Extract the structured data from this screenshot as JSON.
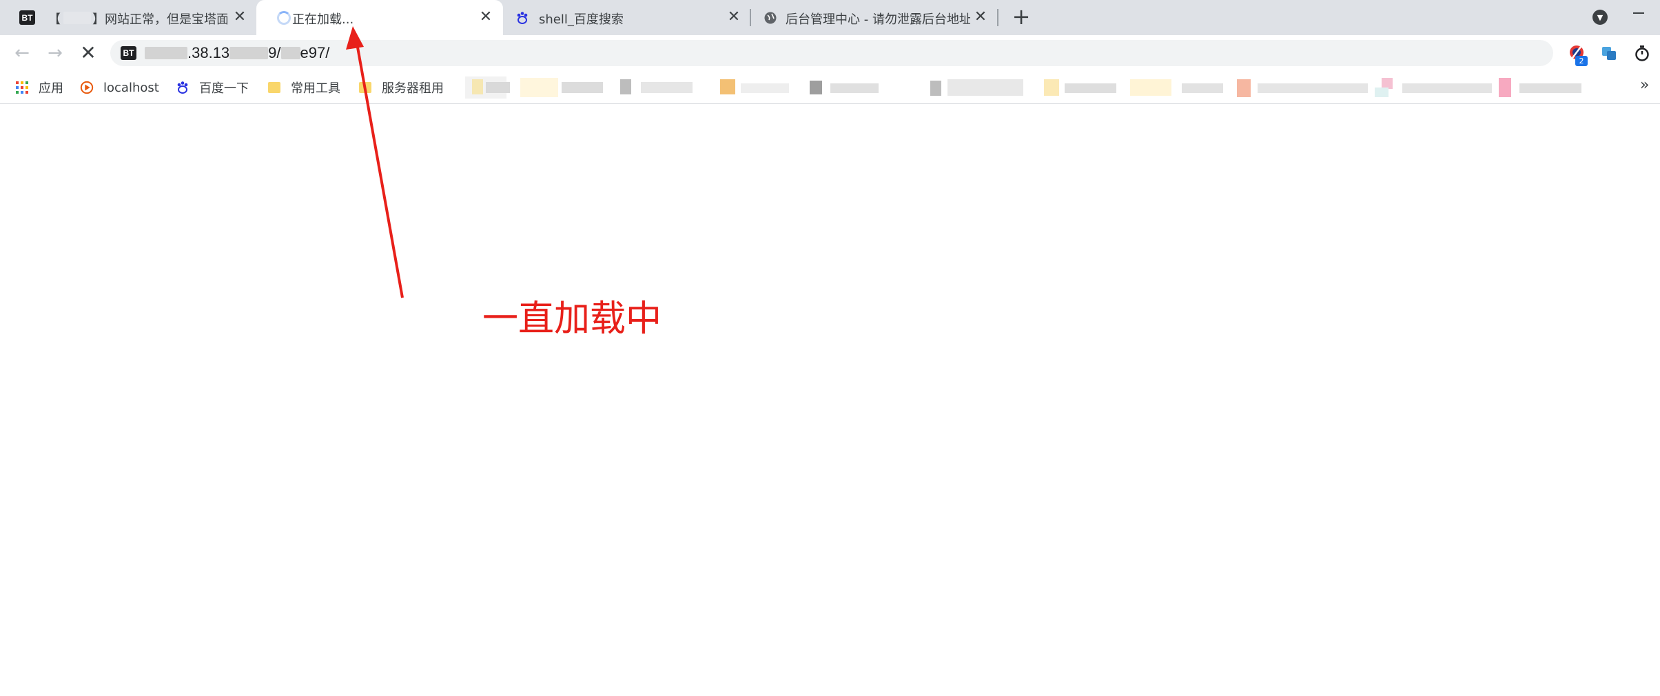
{
  "tabs": [
    {
      "favicon": "bt-badge-icon",
      "prefix": "【",
      "title": "】网站正常，但是宝塔面",
      "active": false
    },
    {
      "favicon": "loading-spinner-icon",
      "title": "正在加载...",
      "active": true
    },
    {
      "favicon": "baidu-paw-icon",
      "title": "shell_百度搜索",
      "active": false
    },
    {
      "favicon": "globe-icon",
      "title": "后台管理中心 - 请勿泄露后台地址",
      "active": false
    }
  ],
  "tab_badge_text": "BT",
  "new_tab_label": "+",
  "address_bar": {
    "site_badge": "BT",
    "url_part1": ".38.13",
    "url_part2": "9/",
    "url_part3": "e97/"
  },
  "extension_badge_count": "2",
  "bookmarks": [
    {
      "icon": "apps-grid-icon",
      "label": "应用"
    },
    {
      "icon": "localhost-icon",
      "label": "localhost"
    },
    {
      "icon": "baidu-paw-icon",
      "label": "百度一下"
    },
    {
      "icon": "folder-icon",
      "label": "常用工具"
    },
    {
      "icon": "folder-icon",
      "label": "服务器租用"
    }
  ],
  "bookmarks_overflow": "»",
  "annotation": {
    "text": "一直加载中",
    "color": "#e8201a"
  },
  "colors": {
    "tabstrip": "#dee1e6",
    "omnibox": "#f1f3f4",
    "accent": "#1a73e8"
  }
}
